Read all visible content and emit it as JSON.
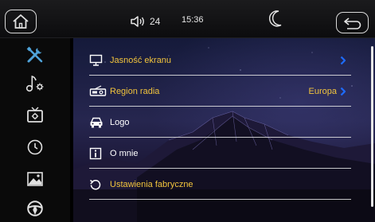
{
  "topbar": {
    "volume": "24",
    "time": "15:36"
  },
  "sidebar": {
    "items": [
      {
        "icon": "tools-icon",
        "active": true
      },
      {
        "icon": "music-settings-icon",
        "active": false
      },
      {
        "icon": "tv-settings-icon",
        "active": false
      },
      {
        "icon": "clock-icon",
        "active": false
      },
      {
        "icon": "picture-icon",
        "active": false
      },
      {
        "icon": "steering-wheel-icon",
        "active": false
      }
    ]
  },
  "settings": {
    "items": [
      {
        "label": "Jasność ekranu",
        "value": "",
        "color": "gold"
      },
      {
        "label": "Region radia",
        "value": "Europa",
        "color": "gold"
      },
      {
        "label": "Logo",
        "value": "",
        "color": "white"
      },
      {
        "label": "O mnie",
        "value": "",
        "color": "white"
      },
      {
        "label": "Ustawienia fabryczne",
        "value": "",
        "color": "gold"
      }
    ]
  },
  "colors": {
    "accent_gold": "#f2c43c",
    "accent_blue": "#1e6cff",
    "active_icon": "#4fa3d9"
  }
}
